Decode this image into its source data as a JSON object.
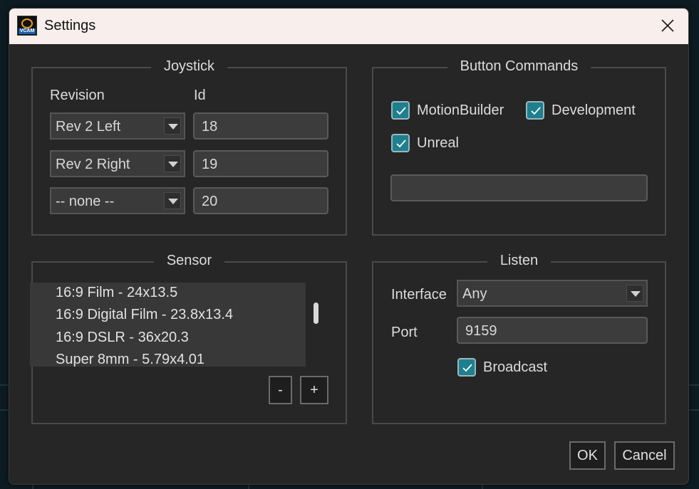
{
  "window": {
    "title": "Settings",
    "icon_caption": "VCAM"
  },
  "joystick": {
    "title": "Joystick",
    "revision_label": "Revision",
    "id_label": "Id",
    "rows": [
      {
        "revision": "Rev 2 Left",
        "id": "18"
      },
      {
        "revision": "Rev 2 Right",
        "id": "19"
      },
      {
        "revision": "-- none --",
        "id": "20"
      }
    ]
  },
  "button_commands": {
    "title": "Button Commands",
    "options": [
      {
        "label": "MotionBuilder",
        "checked": true
      },
      {
        "label": "Development",
        "checked": true
      },
      {
        "label": "Unreal",
        "checked": true
      }
    ],
    "text_value": ""
  },
  "sensor": {
    "title": "Sensor",
    "items": [
      "16:9 Film - 24x13.5",
      "16:9 Digital Film - 23.8x13.4",
      "16:9 DSLR - 36x20.3",
      "Super 8mm - 5.79x4.01"
    ],
    "remove_label": "-",
    "add_label": "+"
  },
  "listen": {
    "title": "Listen",
    "interface_label": "Interface",
    "interface_value": "Any",
    "port_label": "Port",
    "port_value": "9159",
    "broadcast_label": "Broadcast",
    "broadcast_checked": true
  },
  "footer": {
    "ok_label": "OK",
    "cancel_label": "Cancel"
  },
  "colors": {
    "accent": "#1f7f8e",
    "panel": "#262626",
    "titlebar": "#f8eeeb"
  }
}
